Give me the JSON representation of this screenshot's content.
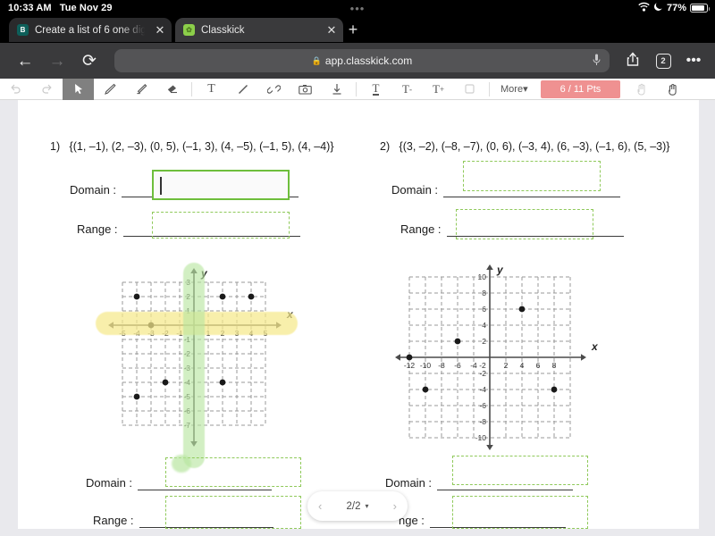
{
  "status_bar": {
    "time": "10:33 AM",
    "date": "Tue Nov 29",
    "center_dots": "•••",
    "wifi_icon": "wifi-icon",
    "dnd_icon": "moon-icon",
    "battery_percent": "77%",
    "battery_icon": "battery-icon"
  },
  "tabs": [
    {
      "title": "Create a list of 6 one digi",
      "favicon": "bim-favicon",
      "close_label": "✕",
      "active": false
    },
    {
      "title": "Classkick",
      "favicon": "classkick-favicon",
      "close_label": "✕",
      "active": true
    }
  ],
  "new_tab_label": "+",
  "browser": {
    "back_icon": "back-arrow-icon",
    "forward_icon": "forward-arrow-icon",
    "reload_icon": "reload-icon",
    "url": "app.classkick.com",
    "lock_icon": "lock-icon",
    "mic_icon": "microphone-icon",
    "share_icon": "share-icon",
    "tab_count": "2",
    "more_icon": "more-dots-icon"
  },
  "classkick_toolbar": {
    "tools": [
      {
        "name": "undo-tool",
        "glyph": "↺",
        "dim": true,
        "selected": false
      },
      {
        "name": "redo-tool",
        "glyph": "↻",
        "dim": true,
        "selected": false
      },
      {
        "name": "select-tool",
        "glyph": "cursor",
        "dim": false,
        "selected": true
      },
      {
        "name": "pen-tool",
        "glyph": "pen",
        "dim": false,
        "selected": false
      },
      {
        "name": "highlighter-tool",
        "glyph": "highlighter",
        "dim": false,
        "selected": false
      },
      {
        "name": "eraser-tool",
        "glyph": "eraser",
        "dim": false,
        "selected": false
      },
      {
        "name": "text-tool",
        "glyph": "T",
        "dim": false,
        "selected": false
      },
      {
        "name": "line-tool",
        "glyph": "line",
        "dim": false,
        "selected": false
      },
      {
        "name": "link-tool",
        "glyph": "link",
        "dim": false,
        "selected": false
      },
      {
        "name": "camera-tool",
        "glyph": "camera",
        "dim": false,
        "selected": false
      },
      {
        "name": "download-tool",
        "glyph": "download",
        "dim": false,
        "selected": false
      },
      {
        "name": "text-underline-tool",
        "glyph": "T_",
        "dim": false,
        "selected": false
      },
      {
        "name": "text-decrease-tool",
        "glyph": "T-",
        "dim": false,
        "selected": false
      },
      {
        "name": "text-increase-tool",
        "glyph": "T+",
        "dim": false,
        "selected": false
      },
      {
        "name": "shape-tool",
        "glyph": "▢",
        "dim": true,
        "selected": false
      }
    ],
    "more_label": "More",
    "more_caret": "▾",
    "points_label": "6 / 11 Pts",
    "points_color": "#ef9191",
    "help_icon": "raise-hand-icon",
    "hand_icon": "hand-icon"
  },
  "worksheet": {
    "problems": [
      {
        "number": "1)",
        "set": "{(1, –1), (2, –3), (0, 5), (–1, 3), (4, –5), (–1, 5), (4, –4)}"
      },
      {
        "number": "2)",
        "set": "{(3, –2), (–8, –7), (0, 6), (–3, 4), (6, –3), (–1, 6), (5, –3)}"
      }
    ],
    "domain_label": "Domain :",
    "range_label": "Range :",
    "range_label_occluded": "nge :",
    "answers": [
      {
        "id": "p1-domain",
        "value": "",
        "state": "active"
      },
      {
        "id": "p1-range",
        "value": "",
        "state": "dashed"
      },
      {
        "id": "p2-domain",
        "value": "",
        "state": "dashed"
      },
      {
        "id": "p2-range",
        "value": "",
        "state": "dashed"
      },
      {
        "id": "p3-domain",
        "value": "",
        "state": "dashed"
      },
      {
        "id": "p3-range",
        "value": "",
        "state": "dashed"
      },
      {
        "id": "p4-domain",
        "value": "",
        "state": "dashed"
      },
      {
        "id": "p4-range",
        "value": "",
        "state": "dashed"
      }
    ]
  },
  "chart_data": [
    {
      "type": "scatter",
      "name": "graph-1",
      "title": "",
      "xlabel": "x",
      "ylabel": "y",
      "xlim": [
        -6,
        6
      ],
      "ylim": [
        -8,
        4
      ],
      "xticks": [
        -5,
        -4,
        -3,
        -2,
        -1,
        1,
        2,
        3,
        4,
        5
      ],
      "yticks": [
        3,
        2,
        1,
        -1,
        -2,
        -3,
        -4,
        -5,
        -6,
        -7
      ],
      "grid": true,
      "points": [
        {
          "x": -4,
          "y": 2
        },
        {
          "x": 2,
          "y": 2
        },
        {
          "x": 4,
          "y": 2
        },
        {
          "x": -3,
          "y": 0
        },
        {
          "x": -2,
          "y": -4
        },
        {
          "x": 2,
          "y": -4
        },
        {
          "x": -4,
          "y": -5
        }
      ],
      "annotations": [
        {
          "type": "highlight",
          "color": "#f6e98b",
          "orientation": "horizontal",
          "over": "x-axis"
        },
        {
          "type": "highlight",
          "color": "#b8e6a0",
          "orientation": "vertical",
          "over": "y-axis"
        }
      ]
    },
    {
      "type": "scatter",
      "name": "graph-2",
      "title": "",
      "xlabel": "x",
      "ylabel": "y",
      "xlim": [
        -13,
        9
      ],
      "ylim": [
        -11,
        11
      ],
      "xticks": [
        -12,
        -10,
        -8,
        -6,
        -4,
        -2,
        2,
        4,
        6,
        8
      ],
      "yticks": [
        10,
        8,
        6,
        4,
        2,
        -2,
        -4,
        -6,
        -8,
        -10
      ],
      "grid": true,
      "points": [
        {
          "x": -12,
          "y": 0
        },
        {
          "x": -6,
          "y": 2
        },
        {
          "x": 4,
          "y": 6
        },
        {
          "x": -10,
          "y": -4
        },
        {
          "x": 8,
          "y": -4
        }
      ],
      "annotations": []
    }
  ],
  "page_nav": {
    "prev_label": "‹",
    "page_label": "2/2",
    "caret": "▾",
    "next_label": "›"
  }
}
